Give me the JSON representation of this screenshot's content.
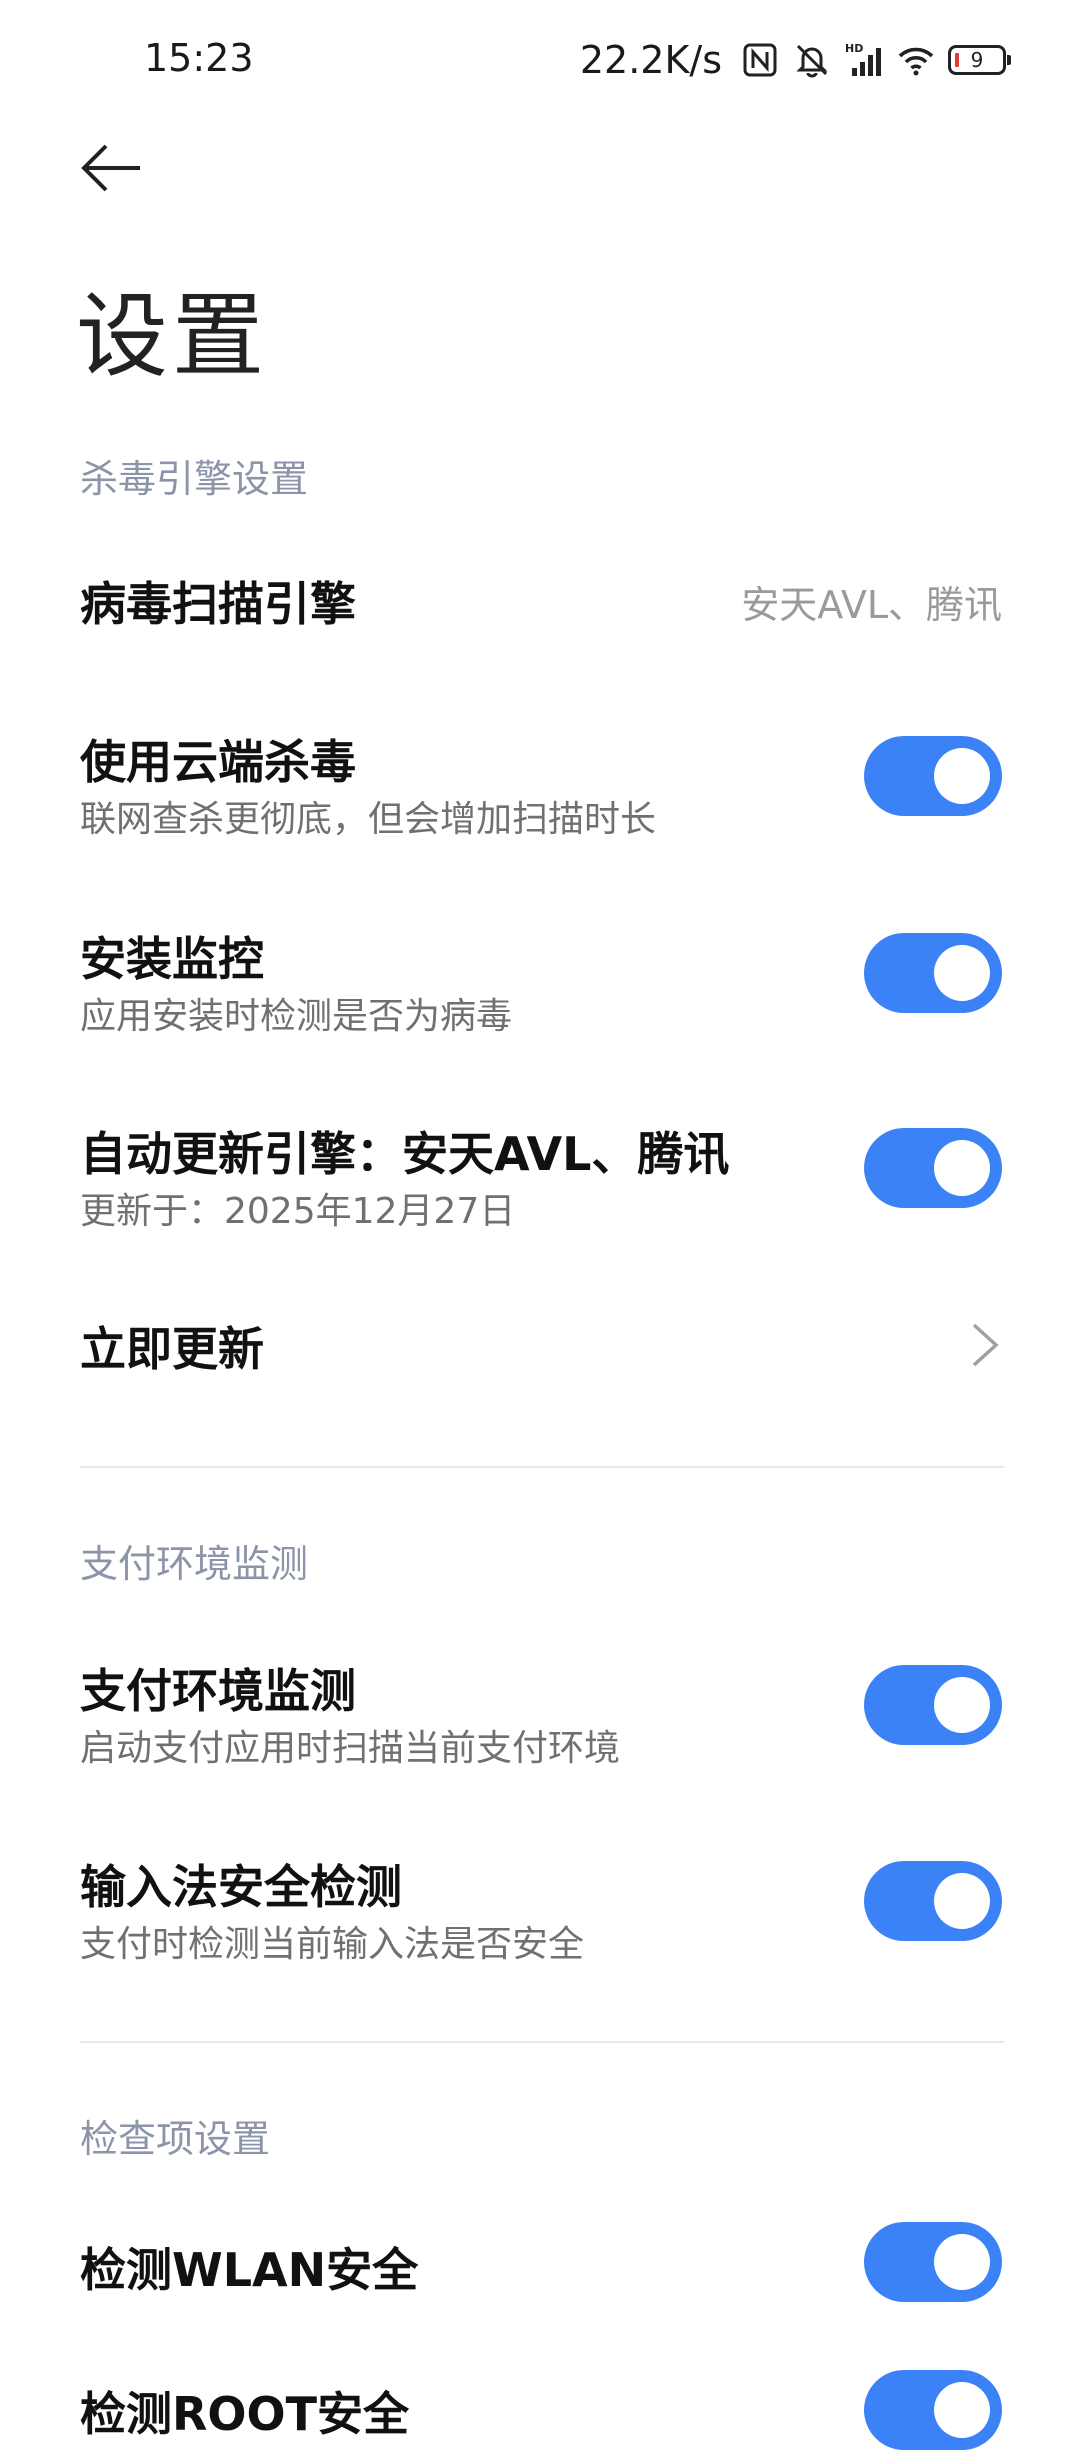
{
  "status_bar": {
    "time": "15:23",
    "net_speed": "22.2K/s",
    "battery": "9",
    "icons": [
      "nfc-icon",
      "bell-off-icon",
      "hd-signal-icon",
      "wifi-icon",
      "battery-icon"
    ]
  },
  "header": {
    "back_icon": "arrow-left-icon",
    "title": "设置"
  },
  "colors": {
    "toggle_on": "#3b82f6",
    "section_title": "#8b94a8",
    "subtitle": "#707070"
  },
  "sections": [
    {
      "title": "杀毒引擎设置",
      "items": [
        {
          "title": "病毒扫描引擎",
          "value": "安天AVL、腾讯"
        },
        {
          "title": "使用云端杀毒",
          "subtitle": "联网查杀更彻底，但会增加扫描时长",
          "toggle": true
        },
        {
          "title": "安装监控",
          "subtitle": "应用安装时检测是否为病毒",
          "toggle": true
        },
        {
          "title": "自动更新引擎：安天AVL、腾讯",
          "subtitle": "更新于：2025年12月27日",
          "toggle": true
        },
        {
          "title": "立即更新",
          "chevron": "chevron-right-icon"
        }
      ]
    },
    {
      "title": "支付环境监测",
      "items": [
        {
          "title": "支付环境监测",
          "subtitle": "启动支付应用时扫描当前支付环境",
          "toggle": true
        },
        {
          "title": "输入法安全检测",
          "subtitle": "支付时检测当前输入法是否安全",
          "toggle": true
        }
      ]
    },
    {
      "title": "检查项设置",
      "items": [
        {
          "title": "检测WLAN安全",
          "toggle": true
        },
        {
          "title": "检测ROOT安全",
          "toggle": true
        }
      ]
    }
  ]
}
